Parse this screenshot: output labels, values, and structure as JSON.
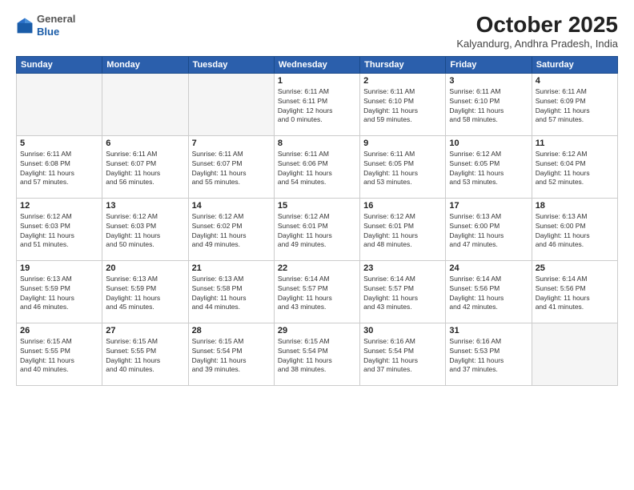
{
  "header": {
    "logo_general": "General",
    "logo_blue": "Blue",
    "month_title": "October 2025",
    "subtitle": "Kalyandurg, Andhra Pradesh, India"
  },
  "weekdays": [
    "Sunday",
    "Monday",
    "Tuesday",
    "Wednesday",
    "Thursday",
    "Friday",
    "Saturday"
  ],
  "weeks": [
    [
      {
        "day": "",
        "info": ""
      },
      {
        "day": "",
        "info": ""
      },
      {
        "day": "",
        "info": ""
      },
      {
        "day": "1",
        "info": "Sunrise: 6:11 AM\nSunset: 6:11 PM\nDaylight: 12 hours\nand 0 minutes."
      },
      {
        "day": "2",
        "info": "Sunrise: 6:11 AM\nSunset: 6:10 PM\nDaylight: 11 hours\nand 59 minutes."
      },
      {
        "day": "3",
        "info": "Sunrise: 6:11 AM\nSunset: 6:10 PM\nDaylight: 11 hours\nand 58 minutes."
      },
      {
        "day": "4",
        "info": "Sunrise: 6:11 AM\nSunset: 6:09 PM\nDaylight: 11 hours\nand 57 minutes."
      }
    ],
    [
      {
        "day": "5",
        "info": "Sunrise: 6:11 AM\nSunset: 6:08 PM\nDaylight: 11 hours\nand 57 minutes."
      },
      {
        "day": "6",
        "info": "Sunrise: 6:11 AM\nSunset: 6:07 PM\nDaylight: 11 hours\nand 56 minutes."
      },
      {
        "day": "7",
        "info": "Sunrise: 6:11 AM\nSunset: 6:07 PM\nDaylight: 11 hours\nand 55 minutes."
      },
      {
        "day": "8",
        "info": "Sunrise: 6:11 AM\nSunset: 6:06 PM\nDaylight: 11 hours\nand 54 minutes."
      },
      {
        "day": "9",
        "info": "Sunrise: 6:11 AM\nSunset: 6:05 PM\nDaylight: 11 hours\nand 53 minutes."
      },
      {
        "day": "10",
        "info": "Sunrise: 6:12 AM\nSunset: 6:05 PM\nDaylight: 11 hours\nand 53 minutes."
      },
      {
        "day": "11",
        "info": "Sunrise: 6:12 AM\nSunset: 6:04 PM\nDaylight: 11 hours\nand 52 minutes."
      }
    ],
    [
      {
        "day": "12",
        "info": "Sunrise: 6:12 AM\nSunset: 6:03 PM\nDaylight: 11 hours\nand 51 minutes."
      },
      {
        "day": "13",
        "info": "Sunrise: 6:12 AM\nSunset: 6:03 PM\nDaylight: 11 hours\nand 50 minutes."
      },
      {
        "day": "14",
        "info": "Sunrise: 6:12 AM\nSunset: 6:02 PM\nDaylight: 11 hours\nand 49 minutes."
      },
      {
        "day": "15",
        "info": "Sunrise: 6:12 AM\nSunset: 6:01 PM\nDaylight: 11 hours\nand 49 minutes."
      },
      {
        "day": "16",
        "info": "Sunrise: 6:12 AM\nSunset: 6:01 PM\nDaylight: 11 hours\nand 48 minutes."
      },
      {
        "day": "17",
        "info": "Sunrise: 6:13 AM\nSunset: 6:00 PM\nDaylight: 11 hours\nand 47 minutes."
      },
      {
        "day": "18",
        "info": "Sunrise: 6:13 AM\nSunset: 6:00 PM\nDaylight: 11 hours\nand 46 minutes."
      }
    ],
    [
      {
        "day": "19",
        "info": "Sunrise: 6:13 AM\nSunset: 5:59 PM\nDaylight: 11 hours\nand 46 minutes."
      },
      {
        "day": "20",
        "info": "Sunrise: 6:13 AM\nSunset: 5:59 PM\nDaylight: 11 hours\nand 45 minutes."
      },
      {
        "day": "21",
        "info": "Sunrise: 6:13 AM\nSunset: 5:58 PM\nDaylight: 11 hours\nand 44 minutes."
      },
      {
        "day": "22",
        "info": "Sunrise: 6:14 AM\nSunset: 5:57 PM\nDaylight: 11 hours\nand 43 minutes."
      },
      {
        "day": "23",
        "info": "Sunrise: 6:14 AM\nSunset: 5:57 PM\nDaylight: 11 hours\nand 43 minutes."
      },
      {
        "day": "24",
        "info": "Sunrise: 6:14 AM\nSunset: 5:56 PM\nDaylight: 11 hours\nand 42 minutes."
      },
      {
        "day": "25",
        "info": "Sunrise: 6:14 AM\nSunset: 5:56 PM\nDaylight: 11 hours\nand 41 minutes."
      }
    ],
    [
      {
        "day": "26",
        "info": "Sunrise: 6:15 AM\nSunset: 5:55 PM\nDaylight: 11 hours\nand 40 minutes."
      },
      {
        "day": "27",
        "info": "Sunrise: 6:15 AM\nSunset: 5:55 PM\nDaylight: 11 hours\nand 40 minutes."
      },
      {
        "day": "28",
        "info": "Sunrise: 6:15 AM\nSunset: 5:54 PM\nDaylight: 11 hours\nand 39 minutes."
      },
      {
        "day": "29",
        "info": "Sunrise: 6:15 AM\nSunset: 5:54 PM\nDaylight: 11 hours\nand 38 minutes."
      },
      {
        "day": "30",
        "info": "Sunrise: 6:16 AM\nSunset: 5:54 PM\nDaylight: 11 hours\nand 37 minutes."
      },
      {
        "day": "31",
        "info": "Sunrise: 6:16 AM\nSunset: 5:53 PM\nDaylight: 11 hours\nand 37 minutes."
      },
      {
        "day": "",
        "info": ""
      }
    ]
  ]
}
